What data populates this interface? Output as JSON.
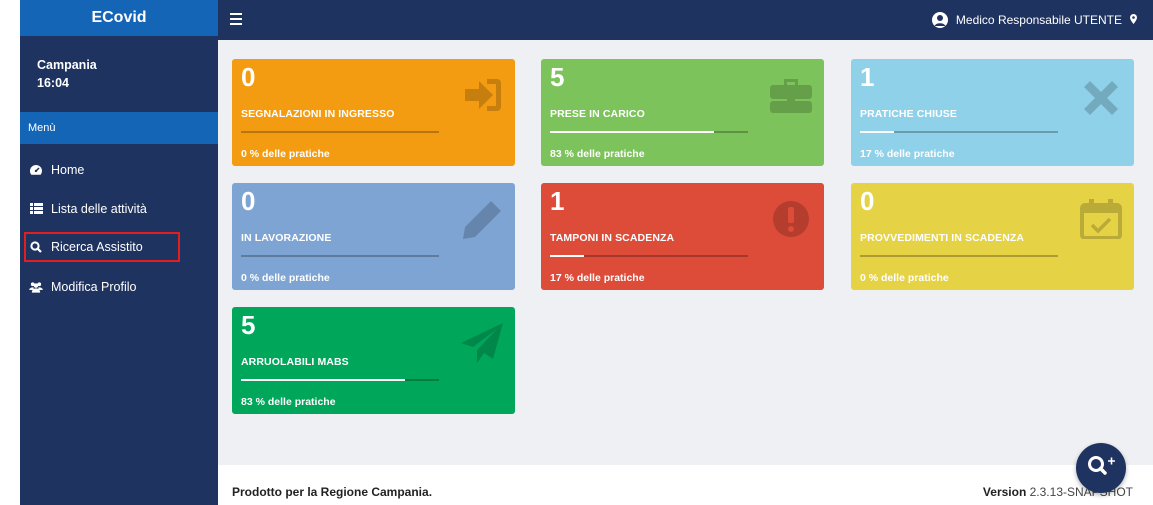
{
  "app": {
    "brand": "ECovid"
  },
  "sidebar": {
    "region": "Campania",
    "time": "16:04",
    "menu_header": "Menù",
    "items": [
      {
        "label": "Home",
        "icon": "dashboard-icon"
      },
      {
        "label": "Lista delle attività",
        "icon": "list-icon"
      },
      {
        "label": "Ricerca Assistito",
        "icon": "search-icon"
      },
      {
        "label": "Modifica Profilo",
        "icon": "users-icon"
      }
    ]
  },
  "header": {
    "user": "Medico Responsabile UTENTE"
  },
  "cards": [
    {
      "count": "0",
      "title": "SEGNALAZIONI IN INGRESSO",
      "percent_text": "0 % delle pratiche",
      "progress": 0,
      "color": "#f39c12",
      "icon": "sign-in-icon"
    },
    {
      "count": "5",
      "title": "PRESE IN CARICO",
      "percent_text": "83 % delle pratiche",
      "progress": 83,
      "color": "#7dc35b",
      "icon": "briefcase-icon"
    },
    {
      "count": "1",
      "title": "PRATICHE CHIUSE",
      "percent_text": "17 % delle pratiche",
      "progress": 17,
      "color": "#8fd1e8",
      "icon": "close-icon"
    },
    {
      "count": "0",
      "title": "IN LAVORAZIONE",
      "percent_text": "0 % delle pratiche",
      "progress": 0,
      "color": "#7ea4d4",
      "icon": "pencil-icon"
    },
    {
      "count": "1",
      "title": "TAMPONI IN SCADENZA",
      "percent_text": "17 % delle pratiche",
      "progress": 17,
      "color": "#dd4b39",
      "icon": "exclamation-icon"
    },
    {
      "count": "0",
      "title": "PROVVEDIMENTI IN SCADENZA",
      "percent_text": "0 % delle pratiche",
      "progress": 0,
      "color": "#e5d245",
      "icon": "calendar-check-icon"
    },
    {
      "count": "5",
      "title": "ARRUOLABILI MABS",
      "percent_text": "83 % delle pratiche",
      "progress": 83,
      "color": "#00a65a",
      "icon": "paper-plane-icon"
    }
  ],
  "footer": {
    "left": "Prodotto per la Regione Campania.",
    "version_label": "Version",
    "version": "2.3.13-SNAPSHOT"
  },
  "fab": {
    "icon": "search-plus-icon"
  }
}
